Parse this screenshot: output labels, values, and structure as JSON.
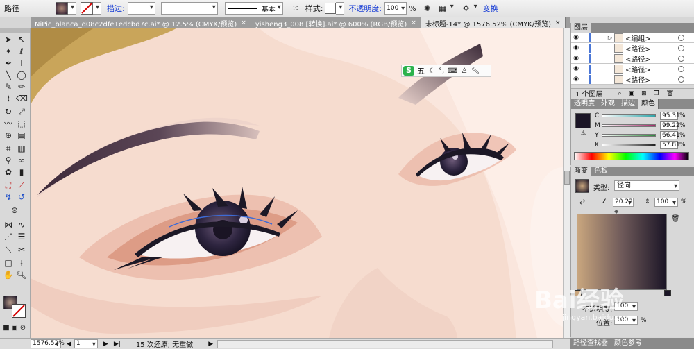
{
  "control_bar": {
    "selection_label": "路径",
    "stroke_label": "描边:",
    "stroke_profile": "基本",
    "style_label": "样式:",
    "opacity_label": "不透明度:",
    "opacity_value": "100",
    "opacity_unit": "%",
    "transform_label": "变换"
  },
  "tabs": [
    {
      "label": "NiPic_blanca_d08c2dfe1edcbd7c.ai* @ 12.5% (CMYK/预览)",
      "close": "×"
    },
    {
      "label": "yisheng3_008 [转换].ai* @ 600% (RGB/预览)",
      "close": "×"
    },
    {
      "label": "未标题-14* @ 1576.52% (CMYK/预览)",
      "close": "×"
    }
  ],
  "ime_toolbar": {
    "logo": "S",
    "mode": "五"
  },
  "layers_panel": {
    "title": "图层",
    "rows": [
      {
        "label": "<编组>"
      },
      {
        "label": "<路径>"
      },
      {
        "label": "<路径>"
      },
      {
        "label": "<路径>"
      },
      {
        "label": "<路径>"
      }
    ],
    "footer": "1 个图层"
  },
  "color_panel": {
    "tabs": [
      "透明度",
      "外观",
      "描边",
      "颜色"
    ],
    "channels": [
      {
        "name": "C",
        "value": "95.31",
        "unit": "%",
        "color": "#2fa4a8"
      },
      {
        "name": "M",
        "value": "99.22",
        "unit": "%",
        "color": "#a42a6a"
      },
      {
        "name": "Y",
        "value": "66.41",
        "unit": "%",
        "color": "#2e8a3d"
      },
      {
        "name": "K",
        "value": "57.81",
        "unit": "%",
        "color": "#222222"
      }
    ]
  },
  "gradient_panel": {
    "tabs": [
      "渐变",
      "色板"
    ],
    "type_label": "类型:",
    "type_value": "径向",
    "angle_value": "20.23",
    "ratio_value": "100",
    "ratio_unit": "%",
    "opacity_label": "不透明度:",
    "opacity_value": "100",
    "location_label": "位置:",
    "location_value": "100",
    "location_unit": "%"
  },
  "bottom_tabs": [
    "路径查找器",
    "颜色参考"
  ],
  "status_bar": {
    "zoom": "1576.52%",
    "page": "1",
    "message": "15 次还原; 无重做"
  },
  "watermark": {
    "text": "Bai经验",
    "url": "jingyan.baidu.com"
  },
  "colors": {
    "skin": "#f6dccf",
    "hair": "#c9a55a",
    "iris": "#2a2440",
    "accent_blue": "#1a3fd6",
    "gradient_start": "#c9a67e",
    "gradient_end": "#1b1526"
  }
}
